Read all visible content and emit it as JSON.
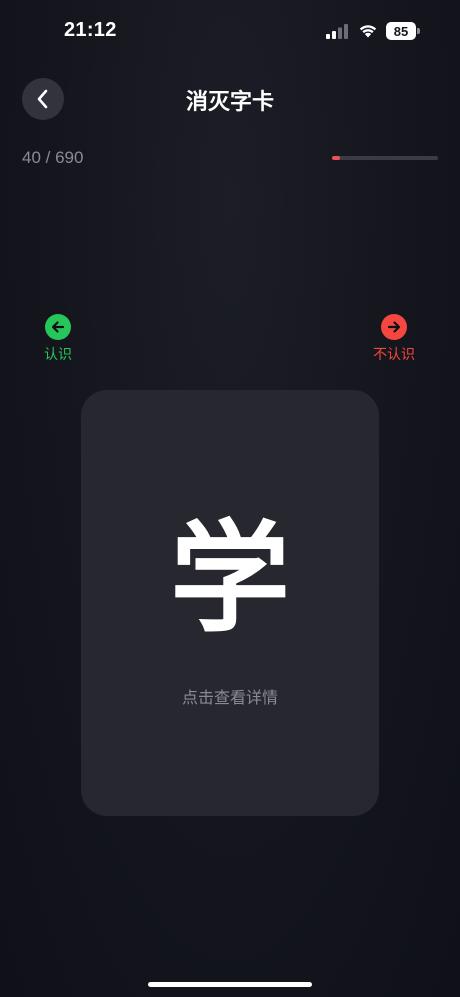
{
  "status_bar": {
    "time": "21:12",
    "battery": "85"
  },
  "header": {
    "title": "消灭字卡",
    "back_icon": "chevron-left-icon"
  },
  "progress": {
    "text": "40 / 690",
    "current": 40,
    "total": 690,
    "fill_color": "#f0505a"
  },
  "hints": {
    "known": {
      "label": "认识",
      "icon": "arrow-left-icon",
      "color": "#27c65a"
    },
    "unknown": {
      "label": "不认识",
      "icon": "arrow-right-icon",
      "color": "#f5473f"
    }
  },
  "card": {
    "character": "学",
    "hint": "点击查看详情"
  }
}
